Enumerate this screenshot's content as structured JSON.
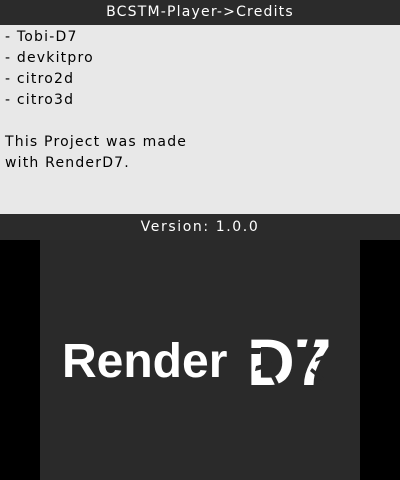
{
  "top_screen": {
    "title": "BCSTM-Player->Credits",
    "credits": [
      "- Tobi-D7",
      "- devkitpro",
      "- citro2d",
      "- citro3d"
    ],
    "description_line_1": "This Project was made",
    "description_line_2": "with RenderD7.",
    "footer": "Version: 1.0.0"
  },
  "bottom_screen": {
    "logo_text_plain": "Render",
    "logo_text_stylized": "D7"
  },
  "colors": {
    "bar_background": "#2b2b2b",
    "content_background": "#e8e8e8",
    "splash_background": "#2a2a2a",
    "logo_color": "#ffffff"
  }
}
